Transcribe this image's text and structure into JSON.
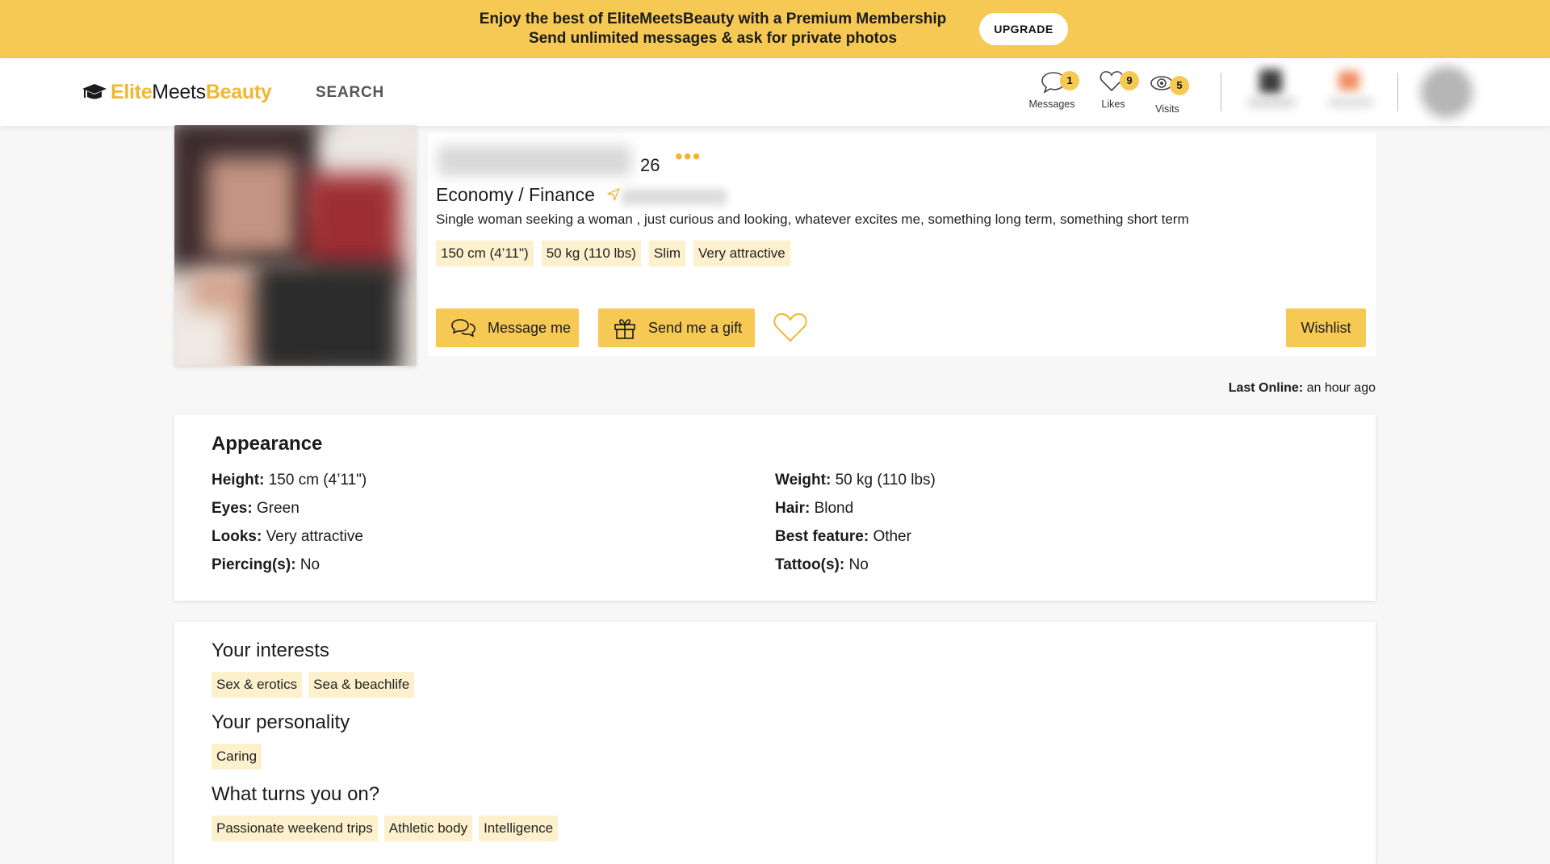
{
  "promo": {
    "line1": "Enjoy the best of EliteMeetsBeauty with a Premium Membership",
    "line2": "Send unlimited messages & ask for private photos",
    "upgrade_label": "UPGRADE"
  },
  "header": {
    "logo": {
      "part1": "Elite",
      "part2": "Meets",
      "part3": "Beauty"
    },
    "search_label": "SEARCH",
    "messages": {
      "count": "1",
      "label": "Messages"
    },
    "likes": {
      "count": "9",
      "label": "Likes"
    },
    "visits": {
      "count": "5",
      "label": "Visits"
    }
  },
  "profile": {
    "age": "26",
    "more_dots": "•••",
    "occupation": "Economy / Finance",
    "description": "Single woman seeking a woman , just curious and looking, whatever excites me, something long term, something short term",
    "tags": [
      "150 cm (4’11\")",
      "50 kg (110 lbs)",
      "Slim",
      "Very attractive"
    ],
    "message_label": "Message me",
    "gift_label": "Send me a gift",
    "wishlist_label": "Wishlist",
    "last_online_label": "Last Online:",
    "last_online_value": "an hour ago"
  },
  "appearance": {
    "title": "Appearance",
    "left": [
      {
        "label": "Height:",
        "value": "150 cm (4’11\")"
      },
      {
        "label": "Eyes:",
        "value": "Green"
      },
      {
        "label": "Looks:",
        "value": "Very attractive"
      },
      {
        "label": "Piercing(s):",
        "value": "No"
      }
    ],
    "right": [
      {
        "label": "Weight:",
        "value": "50 kg (110 lbs)"
      },
      {
        "label": "Hair:",
        "value": "Blond"
      },
      {
        "label": "Best feature:",
        "value": "Other"
      },
      {
        "label": "Tattoo(s):",
        "value": "No"
      }
    ]
  },
  "interests": {
    "interests_title": "Your interests",
    "interests": [
      "Sex & erotics",
      "Sea & beachlife"
    ],
    "personality_title": "Your personality",
    "personality": [
      "Caring"
    ],
    "turnons_title": "What turns you on?",
    "turnons": [
      "Passionate weekend trips",
      "Athletic body",
      "Intelligence"
    ]
  },
  "colors": {
    "accent": "#f6c955",
    "tag_bg": "#fdf0cc",
    "logo_accent": "#f2b632"
  }
}
